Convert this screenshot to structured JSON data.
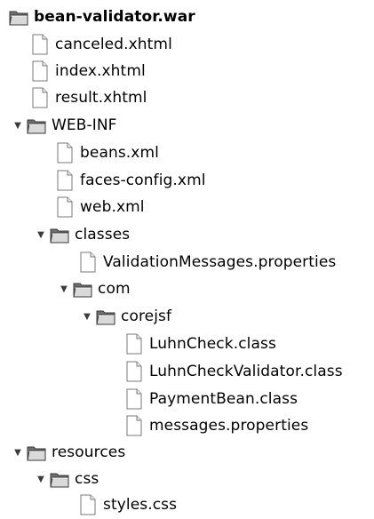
{
  "tree": {
    "root": {
      "label": "bean-validator.war",
      "icon": "folder-icon"
    },
    "items": [
      {
        "label": "canceled.xhtml",
        "icon": "file-icon"
      },
      {
        "label": "index.xhtml",
        "icon": "file-icon"
      },
      {
        "label": "result.xhtml",
        "icon": "file-icon"
      },
      {
        "label": "WEB-INF",
        "icon": "folder-icon",
        "expanded": true
      },
      {
        "label": "beans.xml",
        "icon": "file-icon"
      },
      {
        "label": "faces-config.xml",
        "icon": "file-icon"
      },
      {
        "label": "web.xml",
        "icon": "file-icon"
      },
      {
        "label": "classes",
        "icon": "folder-icon",
        "expanded": true
      },
      {
        "label": "ValidationMessages.properties",
        "icon": "file-icon"
      },
      {
        "label": "com",
        "icon": "folder-icon",
        "expanded": true
      },
      {
        "label": "corejsf",
        "icon": "folder-icon",
        "expanded": true
      },
      {
        "label": "LuhnCheck.class",
        "icon": "file-icon"
      },
      {
        "label": "LuhnCheckValidator.class",
        "icon": "file-icon"
      },
      {
        "label": "PaymentBean.class",
        "icon": "file-icon"
      },
      {
        "label": "messages.properties",
        "icon": "file-icon"
      },
      {
        "label": "resources",
        "icon": "folder-icon",
        "expanded": true
      },
      {
        "label": "css",
        "icon": "folder-icon",
        "expanded": true
      },
      {
        "label": "styles.css",
        "icon": "file-icon"
      }
    ],
    "expander_glyph": "▼"
  }
}
